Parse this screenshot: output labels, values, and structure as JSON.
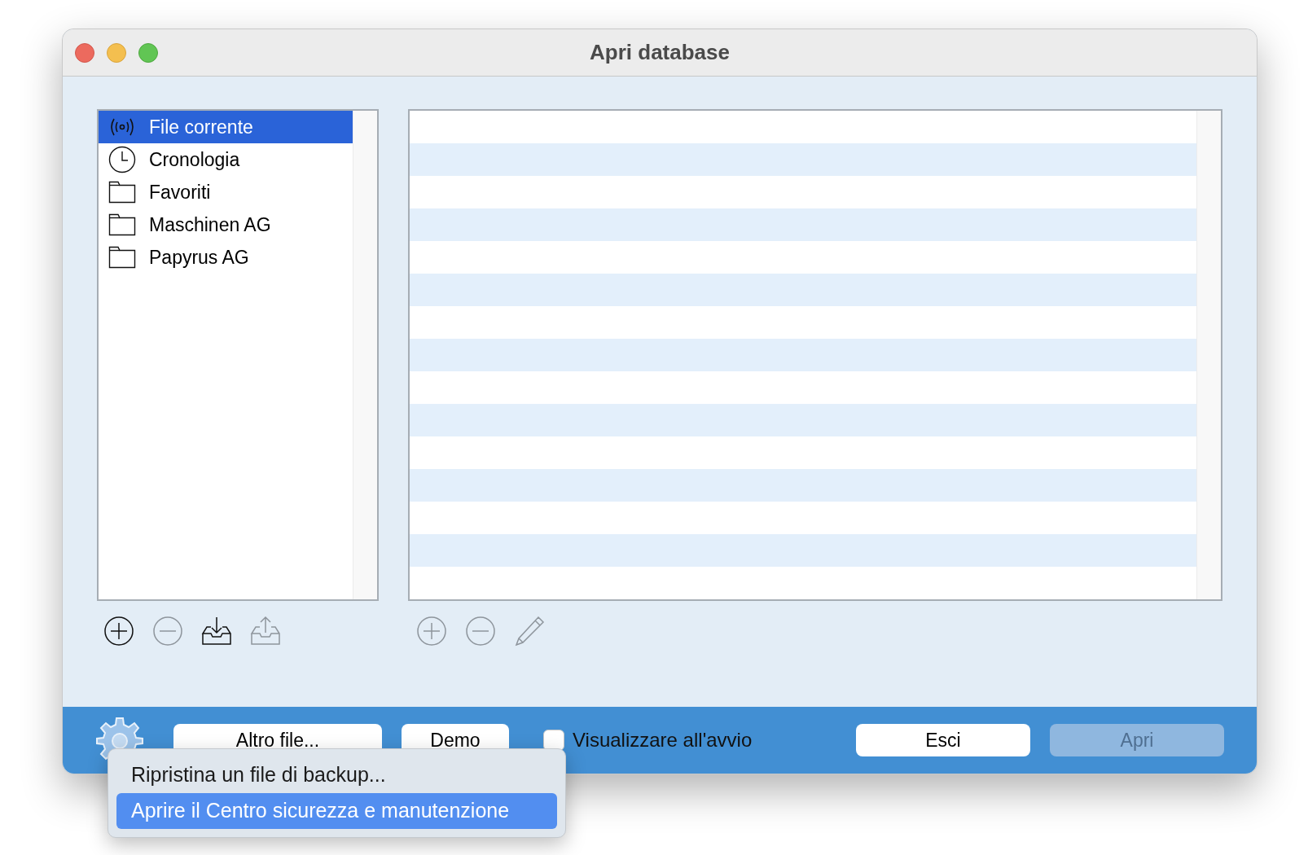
{
  "window": {
    "title": "Apri database"
  },
  "sidebar": {
    "items": [
      {
        "label": "File corrente",
        "kind": "broadcast",
        "selected": true
      },
      {
        "label": "Cronologia",
        "kind": "clock",
        "selected": false
      },
      {
        "label": "Favoriti",
        "kind": "folder",
        "selected": false
      },
      {
        "label": "Maschinen AG",
        "kind": "folder",
        "selected": false
      },
      {
        "label": "Papyrus AG",
        "kind": "folder",
        "selected": false
      }
    ]
  },
  "sidebar_toolbar": [
    {
      "kind": "add",
      "disabled": false
    },
    {
      "kind": "remove",
      "disabled": true
    },
    {
      "kind": "import",
      "disabled": false
    },
    {
      "kind": "export",
      "disabled": true
    }
  ],
  "table_toolbar": [
    {
      "kind": "add",
      "disabled": true
    },
    {
      "kind": "remove",
      "disabled": true
    },
    {
      "kind": "edit",
      "disabled": true
    }
  ],
  "bottom_bar": {
    "buttons": [
      {
        "label": "Altro file...",
        "disabled": false
      },
      {
        "label": "Demo",
        "disabled": false
      }
    ],
    "checkbox": {
      "label": "Visualizzare all'avvio",
      "checked": false
    },
    "actions": [
      {
        "label": "Esci",
        "disabled": false
      },
      {
        "label": "Apri",
        "disabled": true
      }
    ]
  },
  "menu": {
    "items": [
      {
        "label": "Ripristina un file di backup...",
        "selected": false
      },
      {
        "label": "Aprire il Centro sicurezza e manutenzione",
        "selected": true
      }
    ]
  }
}
